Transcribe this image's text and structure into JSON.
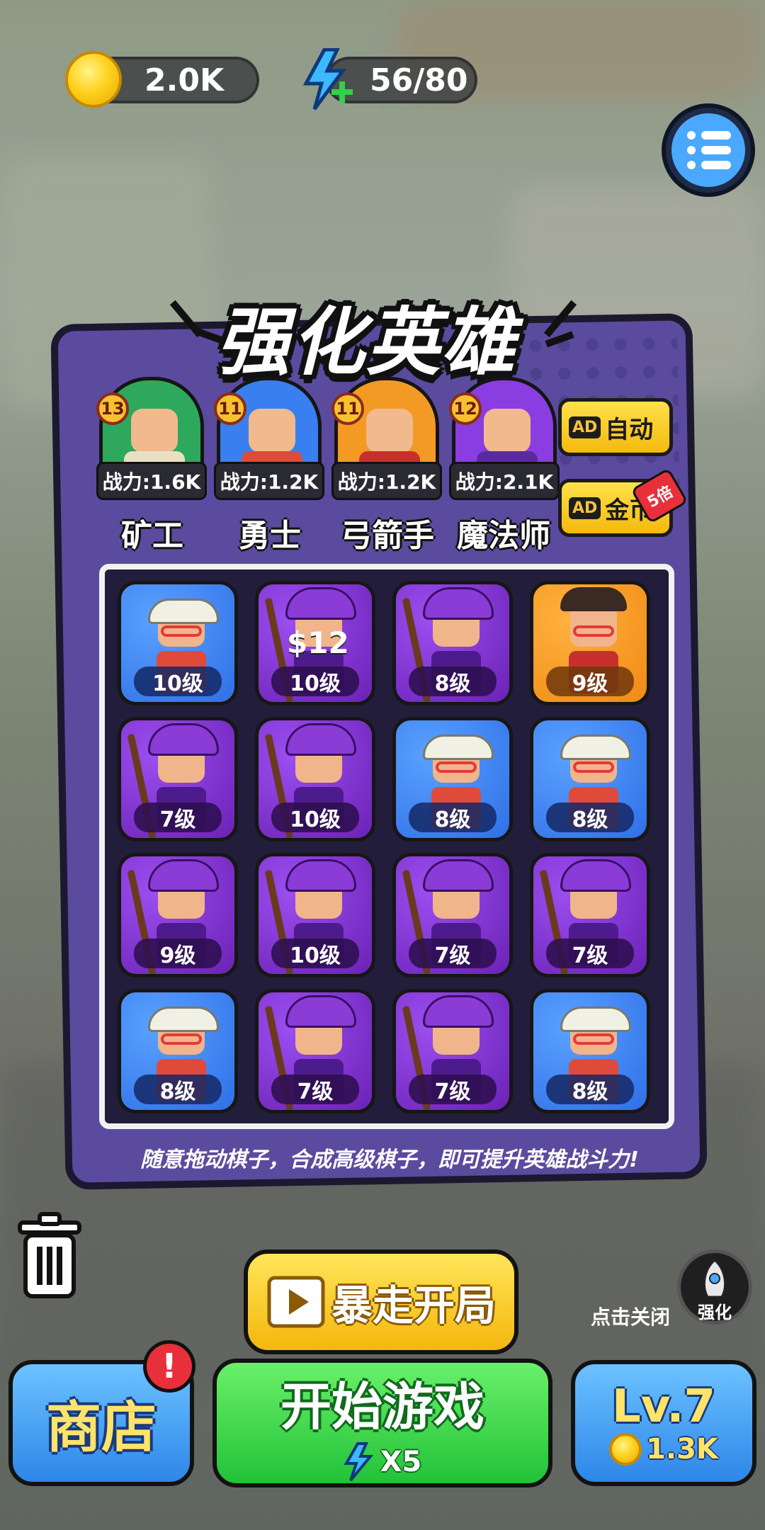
{
  "top_bar": {
    "coins": "2.0K",
    "energy": "56/80"
  },
  "panel": {
    "title": "强化英雄",
    "heroes": [
      {
        "level": "13",
        "power": "战力:1.6K",
        "name": "矿工",
        "color": "#2ea85c"
      },
      {
        "level": "11",
        "power": "战力:1.2K",
        "name": "勇士",
        "color": "#3a7ff0"
      },
      {
        "level": "11",
        "power": "战力:1.2K",
        "name": "弓箭手",
        "color": "#f39a25"
      },
      {
        "level": "12",
        "power": "战力:2.1K",
        "name": "魔法师",
        "color": "#8a3de0"
      }
    ],
    "auto_button": {
      "ad": "AD",
      "label": "自动"
    },
    "coin_button": {
      "ad": "AD",
      "label": "金币",
      "tag": "5倍"
    },
    "board": [
      {
        "type": "blue",
        "hero": "warrior",
        "level": "10级"
      },
      {
        "type": "purple",
        "hero": "mage",
        "level": "10级",
        "reward": "$12"
      },
      {
        "type": "purple",
        "hero": "mage",
        "level": "8级"
      },
      {
        "type": "orange",
        "hero": "archer",
        "level": "9级"
      },
      {
        "type": "purple",
        "hero": "mage",
        "level": "7级"
      },
      {
        "type": "purple",
        "hero": "mage",
        "level": "10级"
      },
      {
        "type": "blue",
        "hero": "warrior",
        "level": "8级"
      },
      {
        "type": "blue",
        "hero": "warrior",
        "level": "8级"
      },
      {
        "type": "purple",
        "hero": "mage",
        "level": "9级"
      },
      {
        "type": "purple",
        "hero": "mage",
        "level": "10级"
      },
      {
        "type": "purple",
        "hero": "mage",
        "level": "7级"
      },
      {
        "type": "purple",
        "hero": "mage",
        "level": "7级"
      },
      {
        "type": "blue",
        "hero": "warrior",
        "level": "8级"
      },
      {
        "type": "purple",
        "hero": "mage",
        "level": "7级"
      },
      {
        "type": "purple",
        "hero": "mage",
        "level": "7级"
      },
      {
        "type": "blue",
        "hero": "warrior",
        "level": "8级"
      }
    ],
    "hint": "随意拖动棋子，合成高级棋子，即可提升英雄战斗力!"
  },
  "bottom": {
    "rush_label": "暴走开局",
    "close_hint": "点击关闭",
    "enhance_label": "强化",
    "shop_label": "商店",
    "alert": "!",
    "start_label": "开始游戏",
    "start_cost": "X5",
    "level_label": "Lv.7",
    "level_cost": "1.3K"
  }
}
